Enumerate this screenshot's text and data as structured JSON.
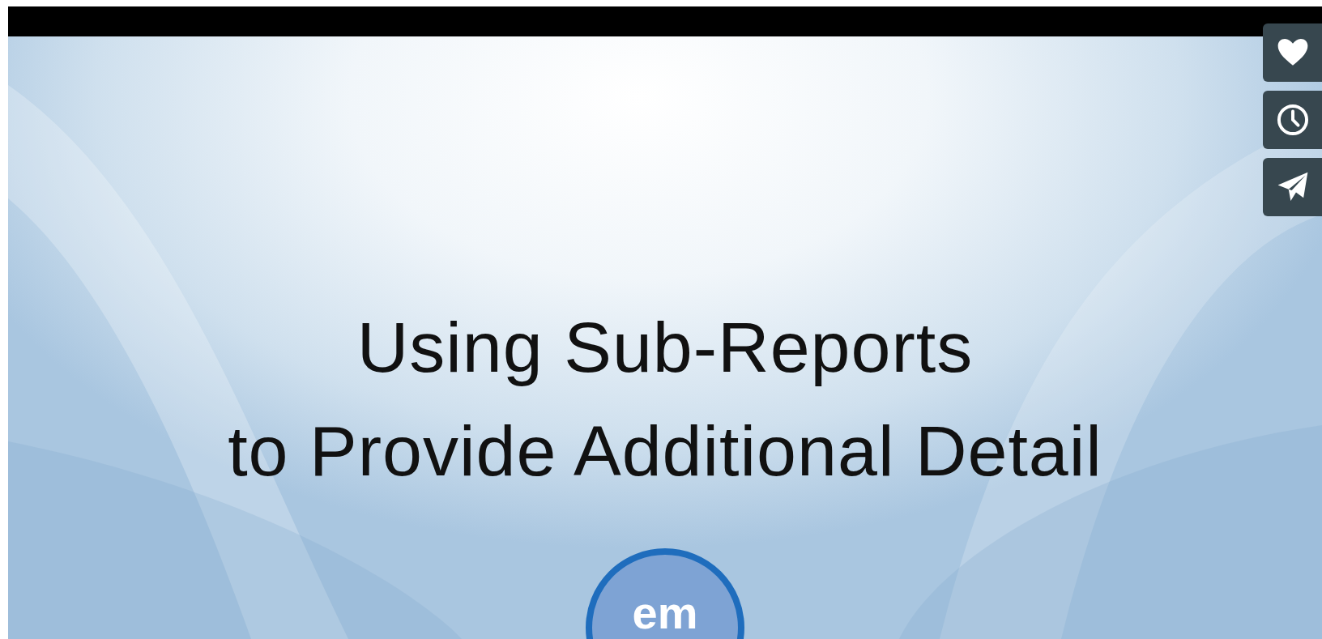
{
  "video": {
    "slide": {
      "title_lines": [
        "Using Sub-Reports",
        "to Provide Additional Detail"
      ],
      "logo_text": "em"
    }
  },
  "side_buttons": [
    {
      "kind": "like"
    },
    {
      "kind": "watch_later"
    },
    {
      "kind": "share"
    }
  ]
}
